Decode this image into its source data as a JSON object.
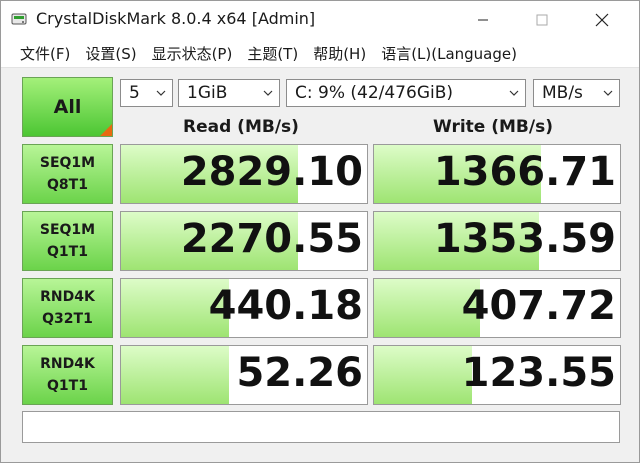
{
  "window": {
    "title": "CrystalDiskMark 8.0.4 x64 [Admin]"
  },
  "menu": [
    {
      "label": "文件(F)"
    },
    {
      "label": "设置(S)"
    },
    {
      "label": "显示状态(P)"
    },
    {
      "label": "主题(T)"
    },
    {
      "label": "帮助(H)"
    },
    {
      "label": "语言(L)(Language)"
    }
  ],
  "controls": {
    "all_label": "All",
    "count": "5",
    "size": "1GiB",
    "drive": "C: 9% (42/476GiB)",
    "unit": "MB/s"
  },
  "headers": {
    "read": "Read (MB/s)",
    "write": "Write (MB/s)"
  },
  "tests": [
    {
      "line1": "SEQ1M",
      "line2": "Q8T1",
      "read": "2829.10",
      "write": "1366.71",
      "read_fill": 0.72,
      "write_fill": 0.68
    },
    {
      "line1": "SEQ1M",
      "line2": "Q1T1",
      "read": "2270.55",
      "write": "1353.59",
      "read_fill": 0.72,
      "write_fill": 0.67
    },
    {
      "line1": "RND4K",
      "line2": "Q32T1",
      "read": "440.18",
      "write": "407.72",
      "read_fill": 0.44,
      "write_fill": 0.43
    },
    {
      "line1": "RND4K",
      "line2": "Q1T1",
      "read": "52.26",
      "write": "123.55",
      "read_fill": 0.44,
      "write_fill": 0.4
    }
  ],
  "status": "",
  "colors": {
    "button_green": "#6bd34a",
    "bar_green": "#9ee472",
    "corner_orange": "#e86a10"
  }
}
